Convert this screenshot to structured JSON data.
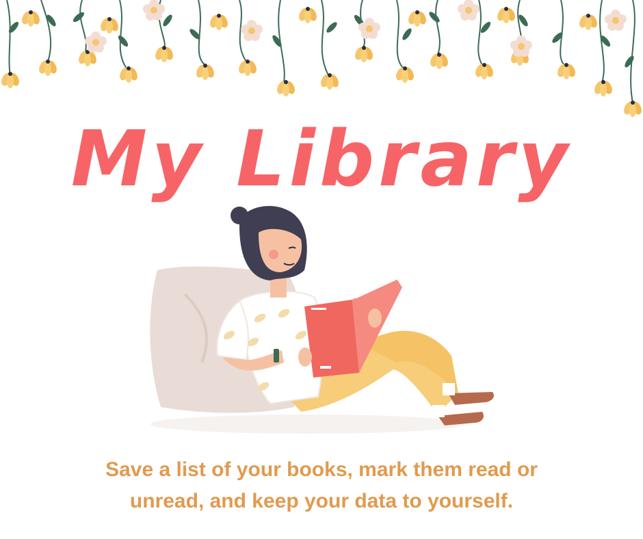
{
  "title": "My Library",
  "tagline": {
    "line1": "Save a list of your books, mark them read or",
    "line2": "unread, and keep your data to yourself."
  },
  "colors": {
    "title": "#f76467",
    "tagline": "#e19a4e",
    "flower_yellow": "#f5c66b",
    "flower_pink": "#f3ddd2",
    "stem": "#3c6b55"
  },
  "icons": {
    "garland": "floral-garland-icon",
    "reader": "reading-girl-illustration"
  }
}
